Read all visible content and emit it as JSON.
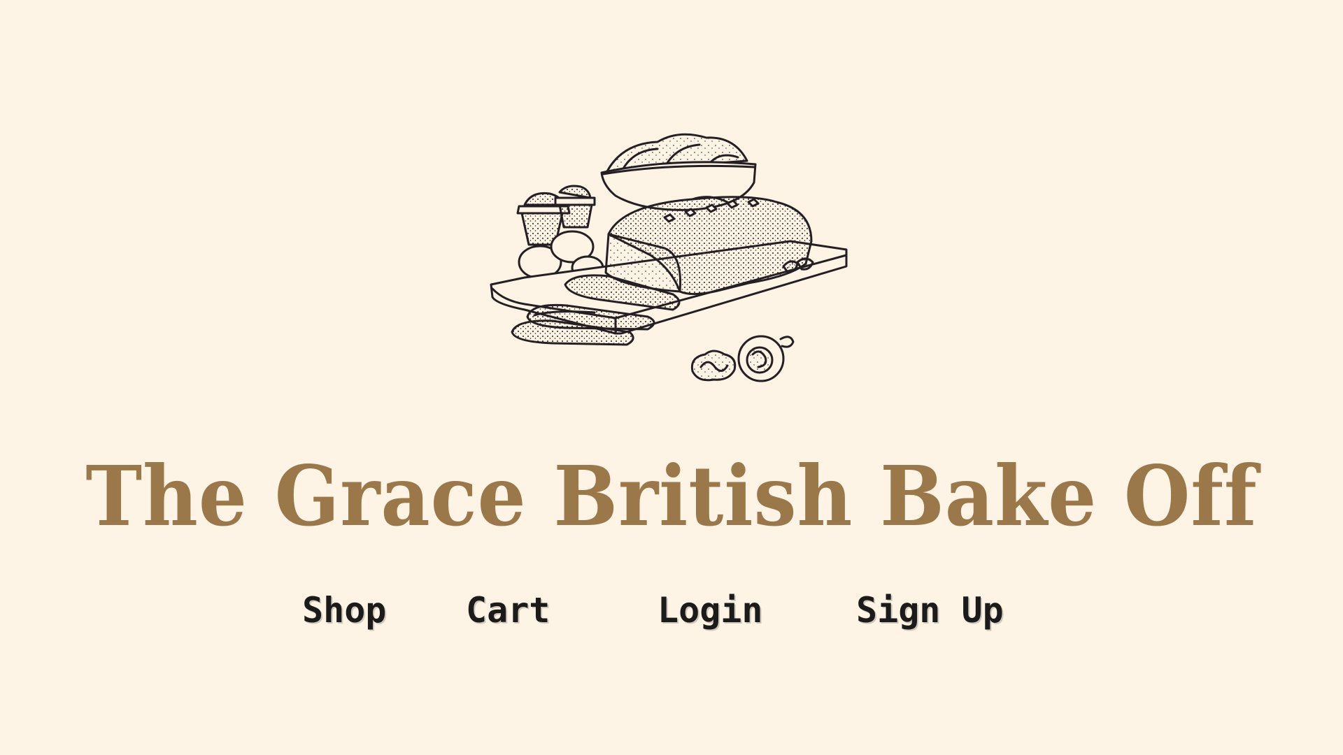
{
  "colors": {
    "background": "#fdf4e6",
    "title": "#9a7849",
    "nav": "#1d1b1a",
    "ink": "#241f22"
  },
  "hero": {
    "icon": "bakery-bread-illustration"
  },
  "site_title": "The Grace British Bake Off",
  "nav": {
    "shop": "Shop",
    "cart": "Cart",
    "login": "Login",
    "signup": "Sign Up"
  }
}
